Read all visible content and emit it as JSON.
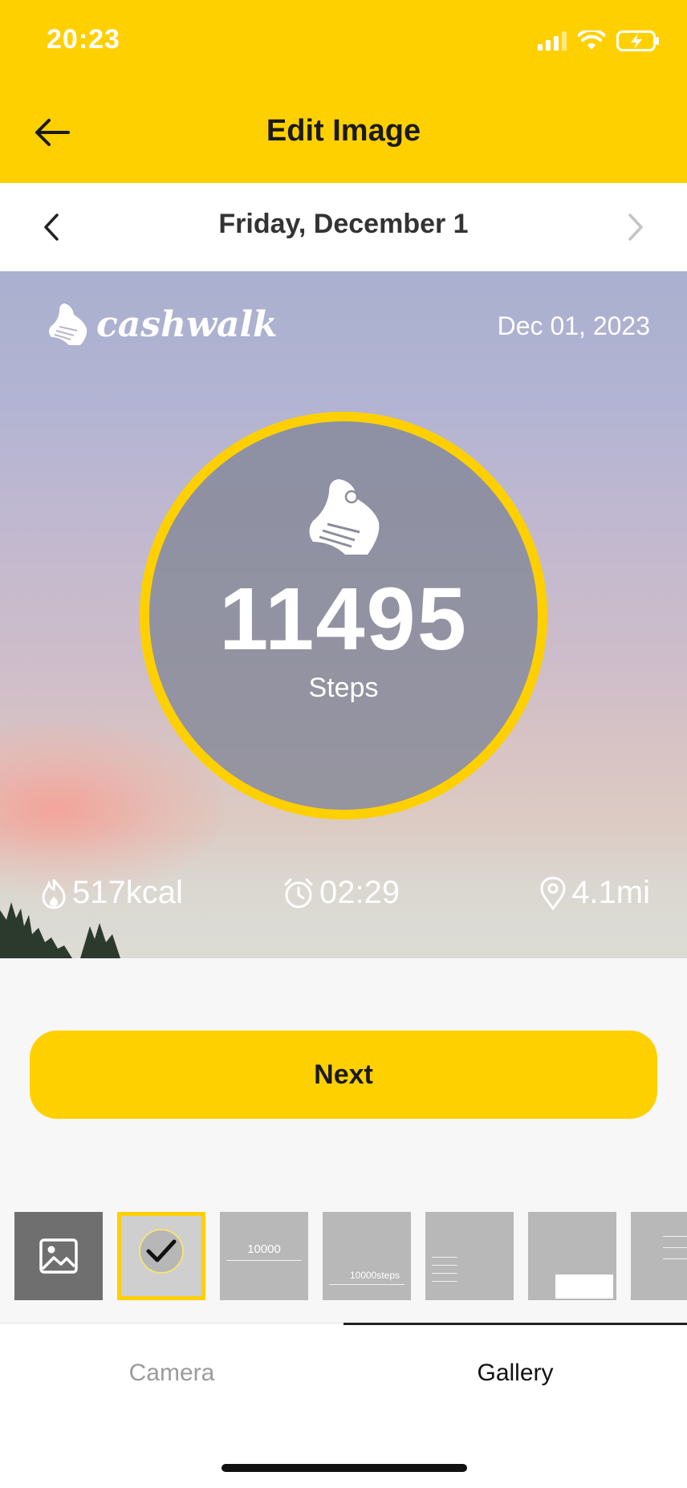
{
  "status_bar": {
    "time": "20:23",
    "icons": [
      "signal-icon",
      "wifi-icon",
      "battery-charging-icon"
    ]
  },
  "header": {
    "title": "Edit Image",
    "back_icon": "arrow-left-icon"
  },
  "date_nav": {
    "date": "Friday, December 1",
    "prev_icon": "chevron-left-icon",
    "next_icon": "chevron-right-icon"
  },
  "card": {
    "brand": "cashwalk",
    "date": "Dec 01, 2023",
    "steps": "11495",
    "steps_label": "Steps",
    "calories": "517kcal",
    "duration": "02:29",
    "distance": "4.1mi"
  },
  "next_button": {
    "label": "Next"
  },
  "thumbnails": [
    {
      "name": "gallery",
      "icon": "image-icon"
    },
    {
      "name": "template-ring",
      "selected": true
    },
    {
      "name": "template-steps-center",
      "text": "10000"
    },
    {
      "name": "template-brand-bottom",
      "text": "10000steps"
    },
    {
      "name": "template-list"
    },
    {
      "name": "template-card"
    },
    {
      "name": "template-partial"
    }
  ],
  "tabs": {
    "camera": "Camera",
    "gallery": "Gallery",
    "active": "gallery"
  },
  "colors": {
    "accent": "#FFD000",
    "text": "#1a1a1a",
    "muted": "#9b9b9b"
  }
}
